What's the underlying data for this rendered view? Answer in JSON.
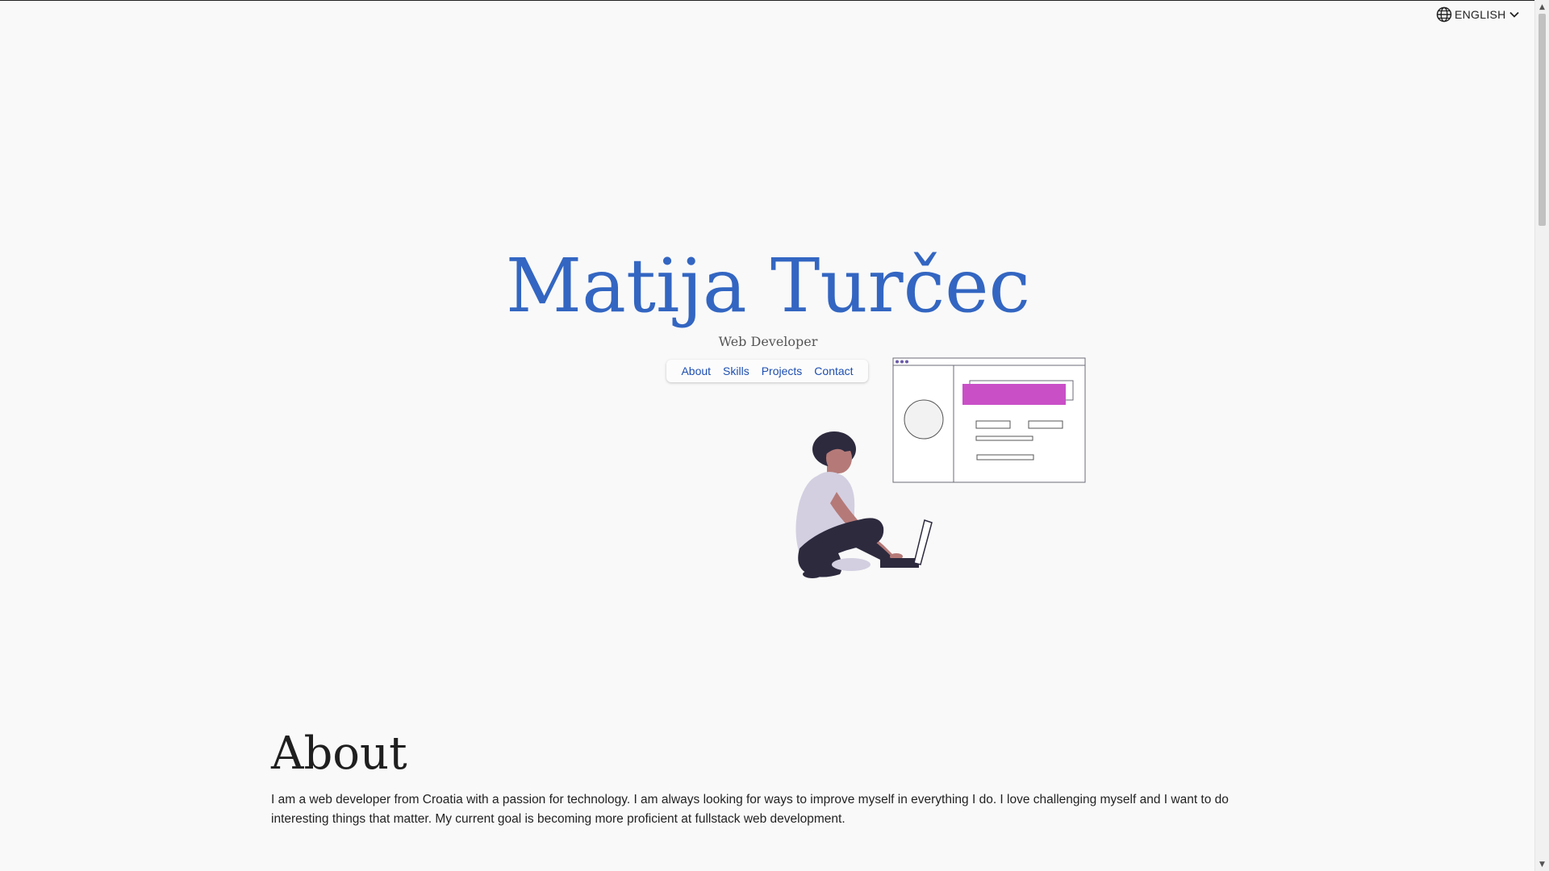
{
  "language": {
    "label": "ENGLISH",
    "icon": "globe-icon",
    "caret_icon": "chevron-down-icon"
  },
  "hero": {
    "name": "Matija Turčec",
    "subtitle": "Web Developer",
    "nav": [
      "About",
      "Skills",
      "Projects",
      "Contact"
    ]
  },
  "about": {
    "heading": "About",
    "text": "I am a web developer from Croatia with a passion for technology. I am always looking for ways to improve myself in everything I do. I love challenging myself and I want to do interesting things that matter. My current goal is becoming more proficient at fullstack web development."
  },
  "colors": {
    "accent": "#3366c2",
    "link": "#1e4fb0",
    "background": "#f9f9f9",
    "illustration_highlight": "#c94fc7"
  }
}
